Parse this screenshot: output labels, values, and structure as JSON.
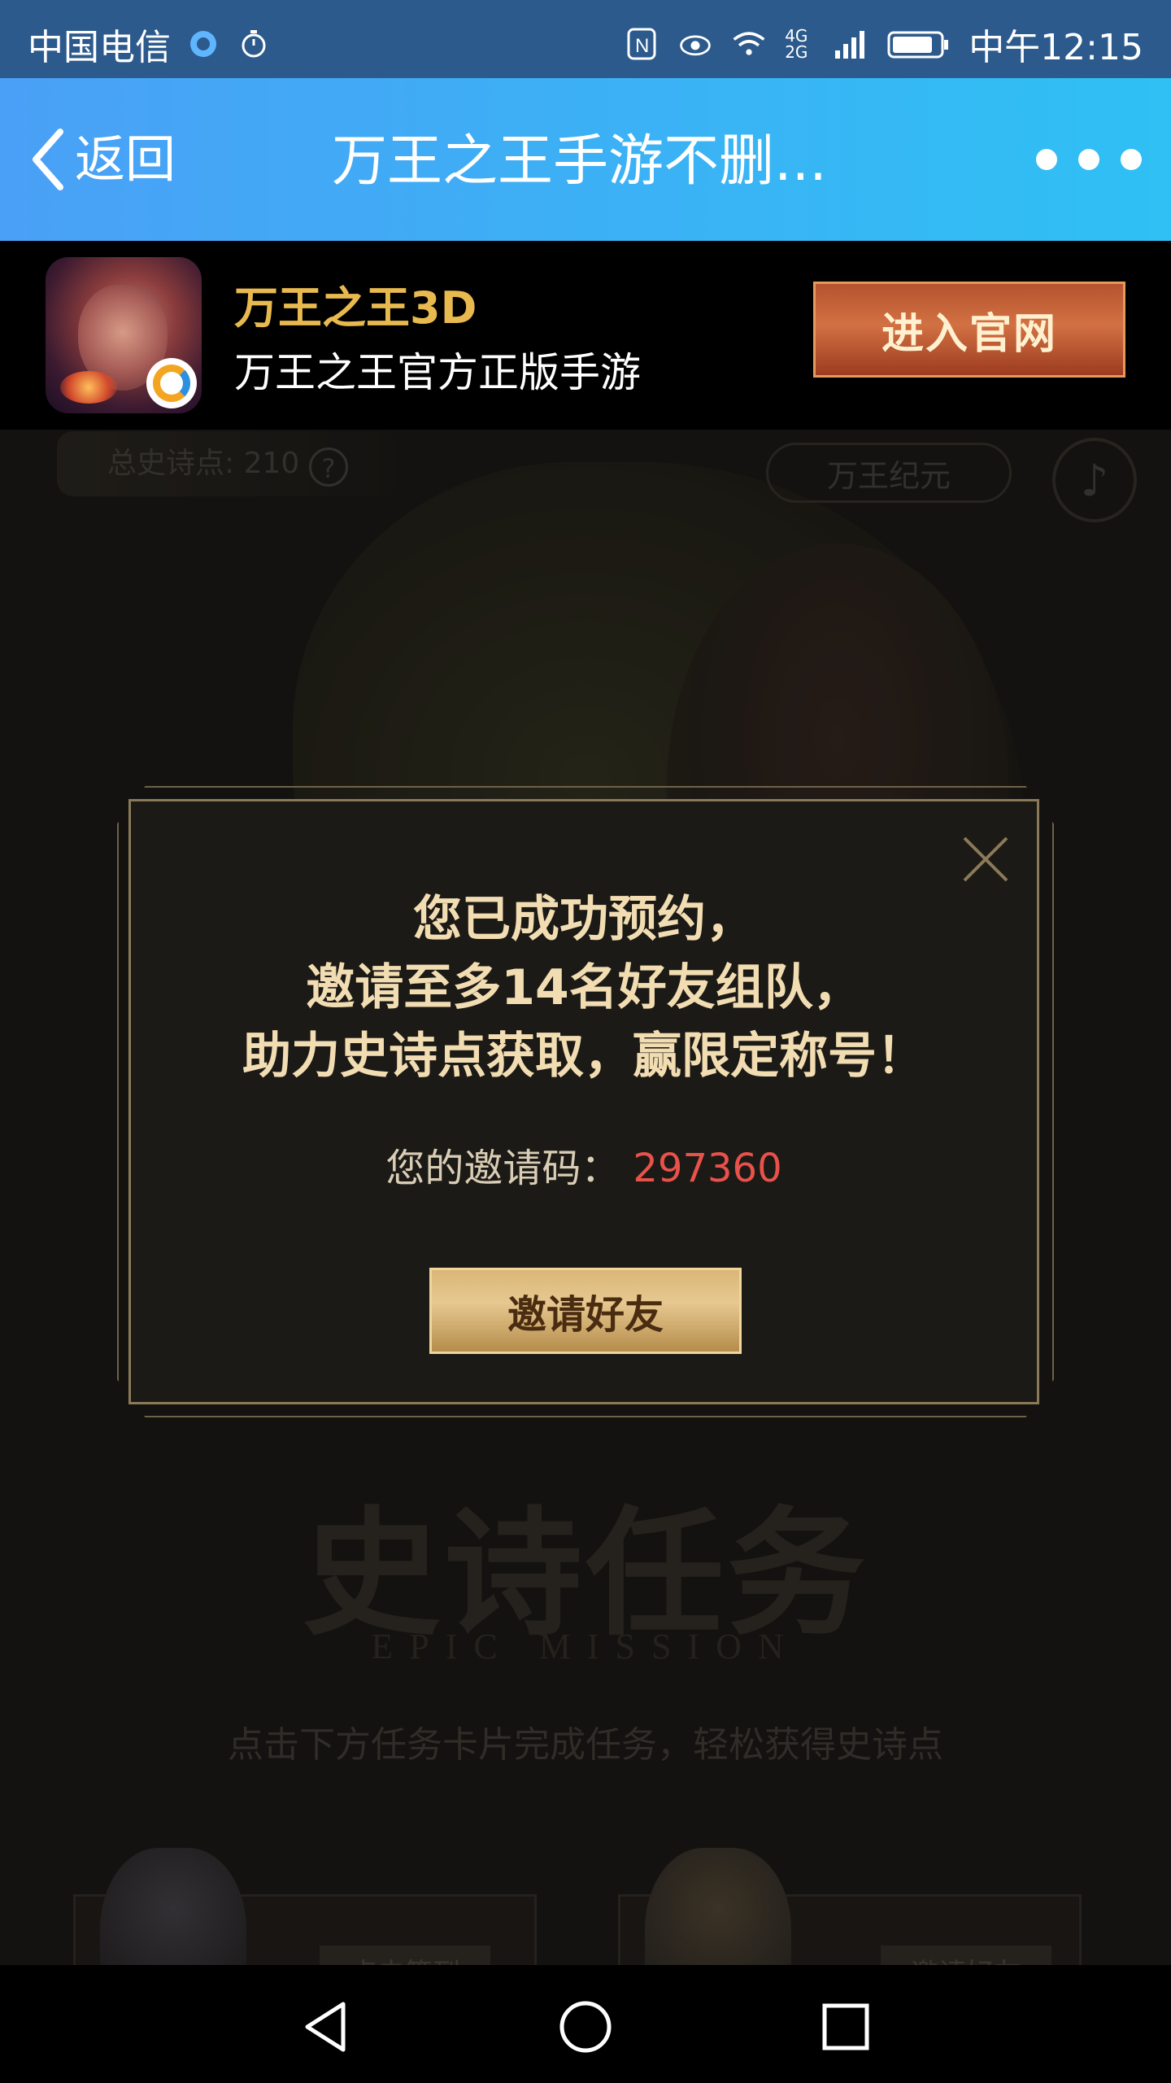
{
  "status_bar": {
    "carrier": "中国电信",
    "network_label": "4G 2G",
    "time": "中午12:15"
  },
  "nav": {
    "back_label": "返回",
    "title": "万王之王手游不删...",
    "more_icon": "more-dots-icon"
  },
  "app_banner": {
    "app_name": "万王之王3D",
    "app_desc": "万王之王官方正版手游",
    "official_button": "进入官网"
  },
  "background": {
    "epic_points": "总史诗点: 210",
    "help_label": "?",
    "era_button": "万王纪元",
    "epic_title": "史诗任务",
    "epic_subtitle": "EPIC MISSION",
    "epic_hint": "点击下方任务卡片完成任务，轻松获得史诗点",
    "task_cards": [
      {
        "button": "点击签到"
      },
      {
        "button": "邀请好友"
      }
    ]
  },
  "modal": {
    "line1": "您已成功预约，",
    "line2": "邀请至多14名好友组队，",
    "line3": "助力史诗点获取，赢限定称号！",
    "code_label": "您的邀请码：",
    "code_value": "297360",
    "invite_button": "邀请好友"
  },
  "colors": {
    "nav_gradient_start": "#4aa0f6",
    "nav_gradient_end": "#2fc0f4",
    "accent_gold": "#e8b94e",
    "code_red": "#e8524a"
  }
}
